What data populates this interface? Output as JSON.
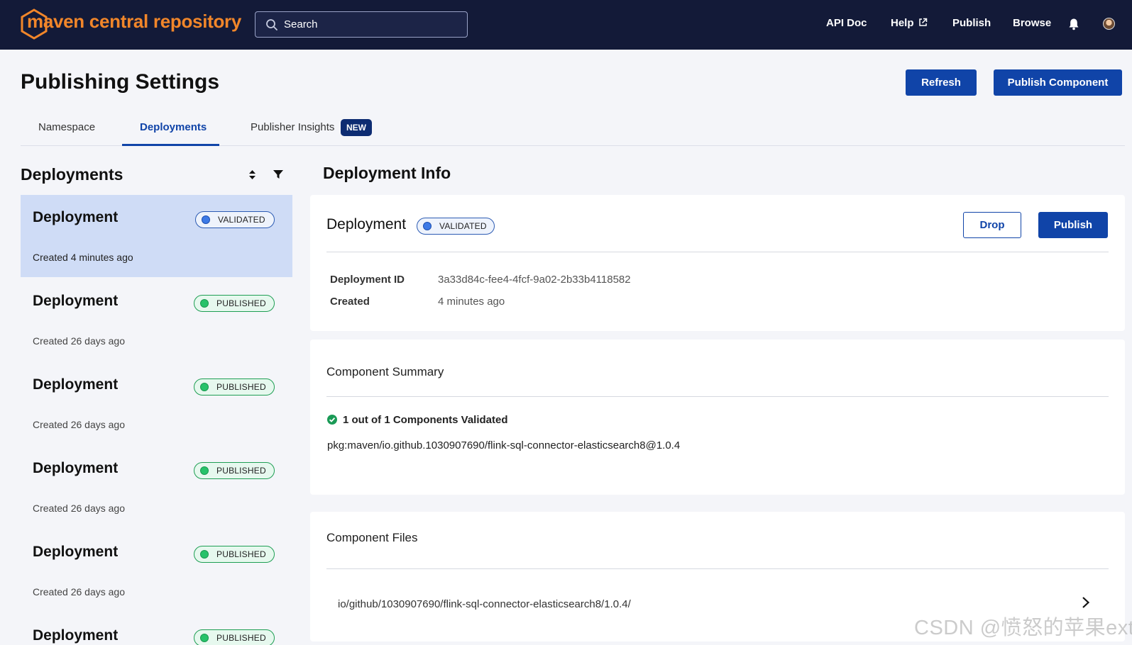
{
  "colors": {
    "nav_bg": "#131a38",
    "brand_orange": "#f1862a",
    "primary": "#1044a8",
    "validated": "#3d7ae6",
    "published": "#27c26a",
    "selected_bg": "#cfdcf6"
  },
  "header": {
    "logo_text": "maven central repository",
    "search_placeholder": "Search",
    "nav": {
      "api_doc": "API Doc",
      "help": "Help",
      "publish": "Publish",
      "browse": "Browse"
    },
    "icons": [
      "search-icon",
      "external-link-icon",
      "bell-icon",
      "avatar"
    ]
  },
  "page": {
    "title": "Publishing Settings",
    "refresh_label": "Refresh",
    "publish_component_label": "Publish Component"
  },
  "tabs": [
    {
      "label": "Namespace",
      "active": false
    },
    {
      "label": "Deployments",
      "active": true
    },
    {
      "label": "Publisher Insights",
      "active": false,
      "badge": "NEW"
    }
  ],
  "deployments_list": {
    "title": "Deployments",
    "items": [
      {
        "name": "Deployment",
        "status": "VALIDATED",
        "created": "Created 4 minutes ago",
        "selected": true
      },
      {
        "name": "Deployment",
        "status": "PUBLISHED",
        "created": "Created 26 days ago",
        "selected": false
      },
      {
        "name": "Deployment",
        "status": "PUBLISHED",
        "created": "Created 26 days ago",
        "selected": false
      },
      {
        "name": "Deployment",
        "status": "PUBLISHED",
        "created": "Created 26 days ago",
        "selected": false
      },
      {
        "name": "Deployment",
        "status": "PUBLISHED",
        "created": "Created 26 days ago",
        "selected": false
      },
      {
        "name": "Deployment",
        "status": "PUBLISHED",
        "created": "",
        "selected": false
      }
    ]
  },
  "deployment_info": {
    "title": "Deployment Info",
    "name": "Deployment",
    "status": "VALIDATED",
    "drop_label": "Drop",
    "publish_label": "Publish",
    "id_label": "Deployment ID",
    "id_value": "3a33d84c-fee4-4fcf-9a02-2b33b4118582",
    "created_label": "Created",
    "created_value": "4 minutes ago"
  },
  "component_summary": {
    "title": "Component Summary",
    "validated_text": "1 out of 1 Components Validated",
    "purl": "pkg:maven/io.github.1030907690/flink-sql-connector-elasticsearch8@1.0.4"
  },
  "component_files": {
    "title": "Component Files",
    "path": "io/github/1030907690/flink-sql-connector-elasticsearch8/1.0.4/"
  },
  "watermark": "CSDN @愤怒的苹果ext"
}
